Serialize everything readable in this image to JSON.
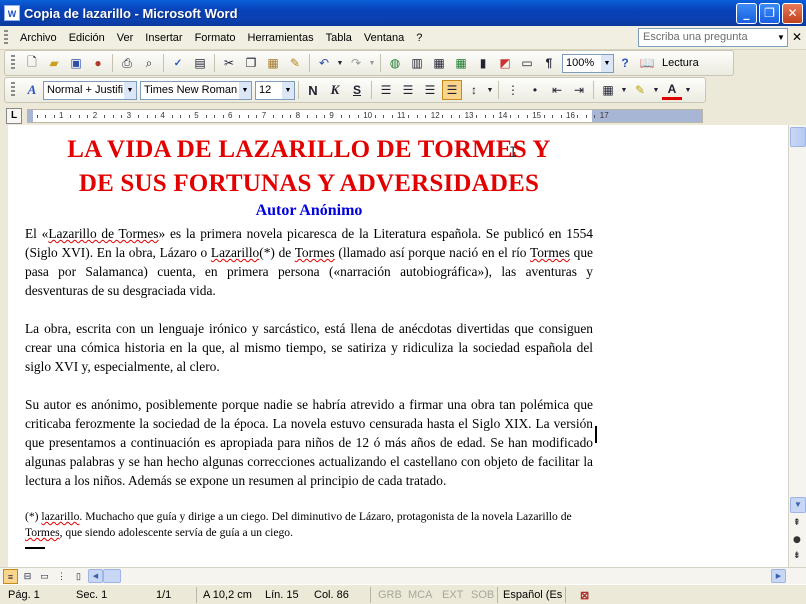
{
  "window": {
    "title": "Copia de lazarillo - Microsoft Word",
    "app_icon": "W",
    "buttons": {
      "minimize": "_",
      "restore": "❐",
      "close": "✕"
    }
  },
  "menu": {
    "items": [
      "Archivo",
      "Edición",
      "Ver",
      "Insertar",
      "Formato",
      "Herramientas",
      "Tabla",
      "Ventana",
      "?"
    ],
    "help_placeholder": "Escriba una pregunta",
    "doc_close": "✕"
  },
  "toolbar_standard": {
    "zoom": "100%",
    "reading_label": "Lectura"
  },
  "toolbar_format": {
    "style": "Normal + Justifi",
    "font": "Times New Roman",
    "size": "12",
    "bold": "N",
    "italic": "K",
    "underline": "S",
    "font_color_letter": "A",
    "accent_color": "#fbd58b"
  },
  "ruler": {
    "numbers": [
      "1",
      "2",
      "3",
      "4",
      "5",
      "6",
      "7",
      "8",
      "9",
      "10",
      "11",
      "12",
      "13",
      "14",
      "15",
      "16",
      "17"
    ]
  },
  "document": {
    "title_line1": "LA VIDA DE LAZARILLO DE TORMES Y",
    "title_line2": "DE SUS FORTUNAS Y ADVERSIDADES",
    "subtitle": "Autor Anónimo",
    "title_color": "#e30000",
    "subtitle_color": "#0000e0",
    "p1": {
      "a": "El «",
      "b": "Lazarillo de Tormes",
      "c": "» es la primera novela picaresca de la Literatura española. Se publicó en 1554 (Siglo XVI). En la obra, Lázaro o ",
      "d": "Lazarillo",
      "e": "(*) de ",
      "f": "Tormes",
      "g": " (llamado así porque nació en el río ",
      "h": "Tormes",
      "i": " que pasa por Salamanca) cuenta, en primera persona («narración autobiográfica»), las aventuras y desventuras de su desgraciada vida."
    },
    "p2": "La obra, escrita con un lenguaje irónico y sarcástico, está llena de anécdotas divertidas que consiguen crear una cómica historia en la que, al mismo tiempo, se satiriza y ridiculiza la sociedad española del siglo XVI y, especialmente, al clero.",
    "p3": "Su autor es anónimo, posiblemente porque nadie se habría atrevido a firmar una obra tan polémica que criticaba ferozmente la sociedad de la época. La novela estuvo censurada hasta el Siglo XIX. La versión que presentamos a continuación es apropiada para niños de 12 ó más años de edad. Se han modificado algunas palabras y se han hecho algunas correcciones actualizando el castellano con objeto de facilitar la lectura a los niños. Además se expone un resumen al principio de cada tratado.",
    "footnote": {
      "a": "(*) ",
      "b": "lazarillo",
      "c": ". Muchacho que guía y dirige a un ciego. Del diminutivo de Lázaro, protagonista de la novela Lazarillo de ",
      "d": "Tormes",
      "e": ", que siendo adolescente servía de guía a un ciego."
    }
  },
  "status": {
    "page": "Pág. 1",
    "section": "Sec. 1",
    "pages": "1/1",
    "at": "A 10,2 cm",
    "line": "Lín. 15",
    "col": "Col. 86",
    "grb": "GRB",
    "mca": "MCA",
    "ext": "EXT",
    "sob": "SOB",
    "language": "Español (Es"
  }
}
